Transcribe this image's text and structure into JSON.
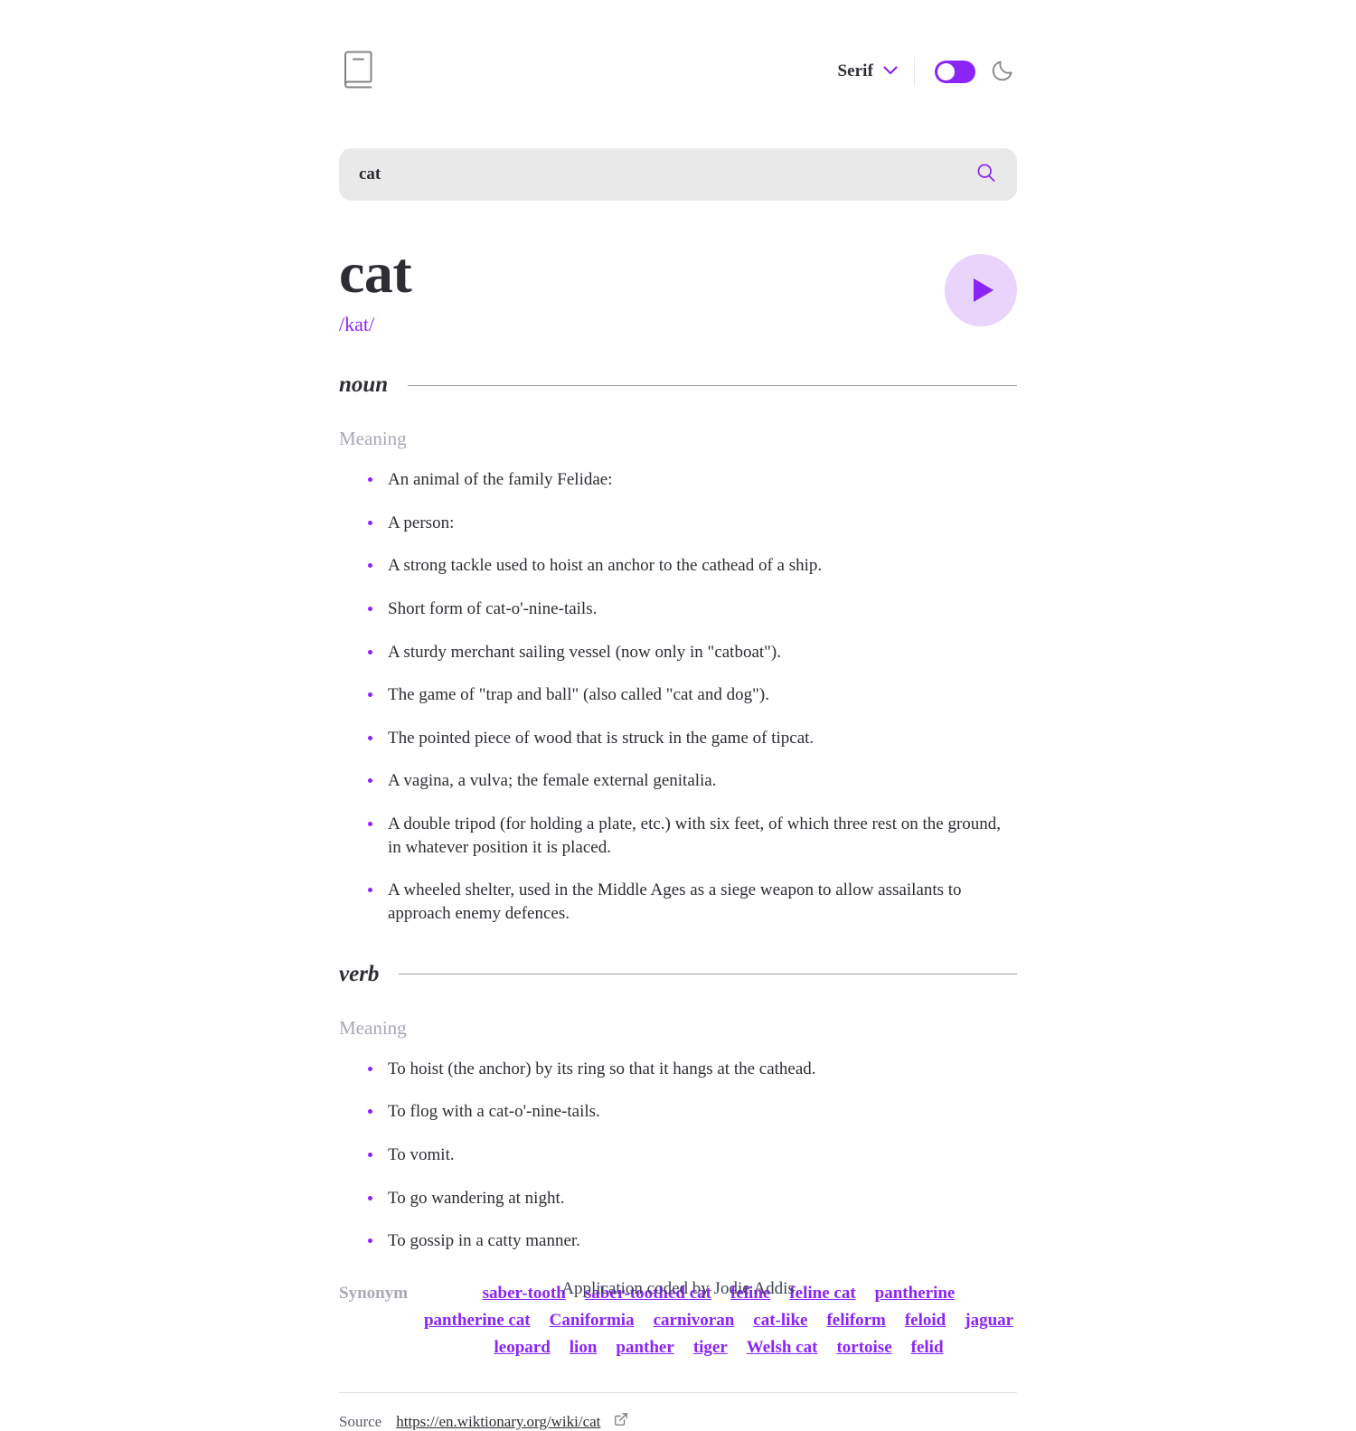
{
  "header": {
    "logo_icon": "book-icon",
    "font_select": {
      "value": "Serif",
      "chevron_icon": "chevron-down-icon"
    },
    "theme_toggle": {
      "state": "off",
      "color": "#8b25f5"
    },
    "theme_icon": "moon-icon"
  },
  "search": {
    "value": "cat",
    "placeholder": "Search for any word…",
    "icon": "search-icon"
  },
  "word": {
    "title": "cat",
    "phonetic": "/kat/",
    "play_icon": "play-icon"
  },
  "sections": [
    {
      "part_of_speech": "noun",
      "meaning_label": "Meaning",
      "definitions": [
        "An animal of the family Felidae:",
        "A person:",
        "A strong tackle used to hoist an anchor to the cathead of a ship.",
        "Short form of cat-o'-nine-tails.",
        "A sturdy merchant sailing vessel (now only in \"catboat\").",
        "The game of \"trap and ball\" (also called \"cat and dog\").",
        "The pointed piece of wood that is struck in the game of tipcat.",
        "A vagina, a vulva; the female external genitalia.",
        "A double tripod (for holding a plate, etc.) with six feet, of which three rest on the ground, in whatever position it is placed.",
        "A wheeled shelter, used in the Middle Ages as a siege weapon to allow assailants to approach enemy defences."
      ]
    },
    {
      "part_of_speech": "verb",
      "meaning_label": "Meaning",
      "definitions": [
        "To hoist (the anchor) by its ring so that it hangs at the cathead.",
        "To flog with a cat-o'-nine-tails.",
        "To vomit.",
        "To go wandering at night.",
        "To gossip in a catty manner."
      ]
    }
  ],
  "synonyms": {
    "label": "Synonym",
    "items": [
      "saber-tooth",
      "saber-toothed cat",
      "feline",
      "feline cat",
      "pantherine",
      "pantherine cat",
      "Caniformia",
      "carnivoran",
      "cat-like",
      "feliform",
      "feloid",
      "jaguar",
      "leopard",
      "lion",
      "panther",
      "tiger",
      "Welsh cat",
      "tortoise",
      "felid"
    ]
  },
  "source": {
    "label": "Source",
    "url": "https://en.wiktionary.org/wiki/cat",
    "icon": "external-link-icon"
  },
  "footer": {
    "text": "Application coded by Jodie Addis"
  },
  "colors": {
    "accent": "#8b25f5",
    "accent_light": "#e9d4fb",
    "search_bg": "#e9e9e9",
    "text": "#2d2d34",
    "muted": "#a9a9b5"
  }
}
